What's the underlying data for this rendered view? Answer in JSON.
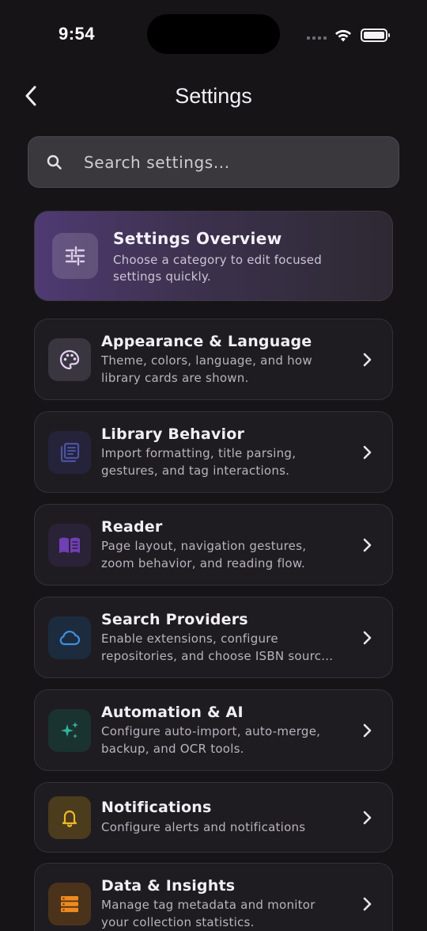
{
  "status": {
    "time": "9:54"
  },
  "nav": {
    "title": "Settings",
    "back_icon": "chevron-left-icon"
  },
  "search": {
    "placeholder": "Search settings...",
    "value": "",
    "icon": "search-icon"
  },
  "overview": {
    "title": "Settings Overview",
    "subtitle_lines": [
      "Choose a category to edit focused",
      "settings quickly."
    ],
    "icon": "sliders-icon"
  },
  "categories": [
    {
      "title": "Appearance & Language",
      "desc_lines": [
        "Theme, colors, language, and how",
        "library cards are shown."
      ],
      "icon": "palette-icon",
      "icon_color": "#d9c4f0",
      "icon_bg": "#3a3640"
    },
    {
      "title": "Library Behavior",
      "desc_lines": [
        "Import formatting, title parsing,",
        "gestures, and tag interactions."
      ],
      "icon": "library-icon",
      "icon_color": "#4a4f8a",
      "icon_bg": "#24233a"
    },
    {
      "title": "Reader",
      "desc_lines": [
        "Page layout, navigation gestures,",
        "zoom behavior, and reading flow."
      ],
      "icon": "book-open-icon",
      "icon_color": "#6f3fb5",
      "icon_bg": "#2a2236"
    },
    {
      "title": "Search Providers",
      "desc_lines": [
        "Enable extensions, configure",
        "repositories, and choose ISBN sourc…"
      ],
      "icon": "cloud-icon",
      "icon_color": "#3f8fe0",
      "icon_bg": "#1c2c3e"
    },
    {
      "title": "Automation & AI",
      "desc_lines": [
        "Configure auto-import, auto-merge,",
        "backup, and OCR tools."
      ],
      "icon": "sparkles-icon",
      "icon_color": "#2fb59a",
      "icon_bg": "#1a3230"
    },
    {
      "title": "Notifications",
      "desc_lines": [
        "Configure alerts and notifications"
      ],
      "icon": "bell-icon",
      "icon_color": "#f0b72a",
      "icon_bg": "#4a3c1c"
    },
    {
      "title": "Data & Insights",
      "desc_lines": [
        "Manage tag metadata and monitor",
        "your collection statistics."
      ],
      "icon": "database-icon",
      "icon_color": "#f08a1e",
      "icon_bg": "#4a331a"
    }
  ]
}
